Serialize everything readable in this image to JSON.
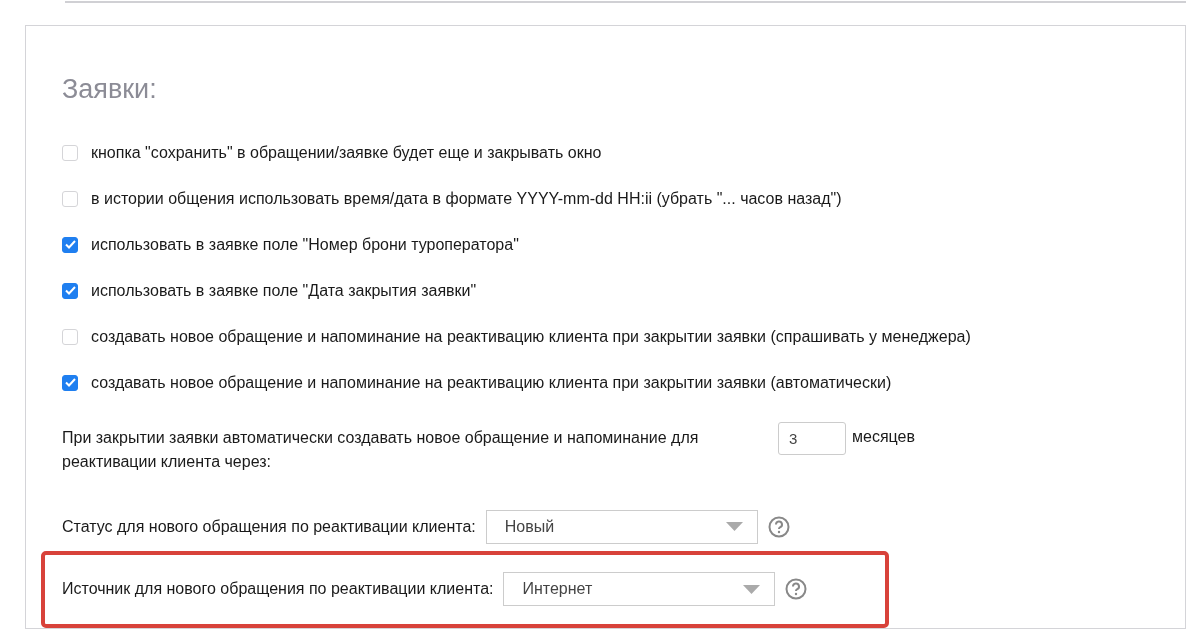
{
  "section": {
    "title": "Заявки:"
  },
  "options": [
    {
      "label": "кнопка \"сохранить\" в обращении/заявке будет еще и закрывать окно",
      "checked": false
    },
    {
      "label": "в истории общения использовать время/дата в формате YYYY-mm-dd HH:ii (убрать \"... часов назад\")",
      "checked": false
    },
    {
      "label": "использовать в заявке поле \"Номер брони туроператора\"",
      "checked": true
    },
    {
      "label": "использовать в заявке поле \"Дата закрытия заявки\"",
      "checked": true
    },
    {
      "label": "создавать новое обращение и напоминание на реактивацию клиента при закрытии заявки (спрашивать у менеджера)",
      "checked": false
    },
    {
      "label": "создавать новое обращение и напоминание на реактивацию клиента при закрытии заявки (автоматически)",
      "checked": true
    }
  ],
  "period": {
    "label": "При закрытии заявки автоматически создавать новое обращение и напоминание для реактивации клиента через:",
    "value": "3",
    "unit": "месяцев"
  },
  "selects": [
    {
      "label": "Статус для нового обращения по реактивации клиента:",
      "value": "Новый",
      "highlighted": false
    },
    {
      "label": "Источник для нового обращения по реактивации клиента:",
      "value": "Интернет",
      "highlighted": true
    }
  ]
}
